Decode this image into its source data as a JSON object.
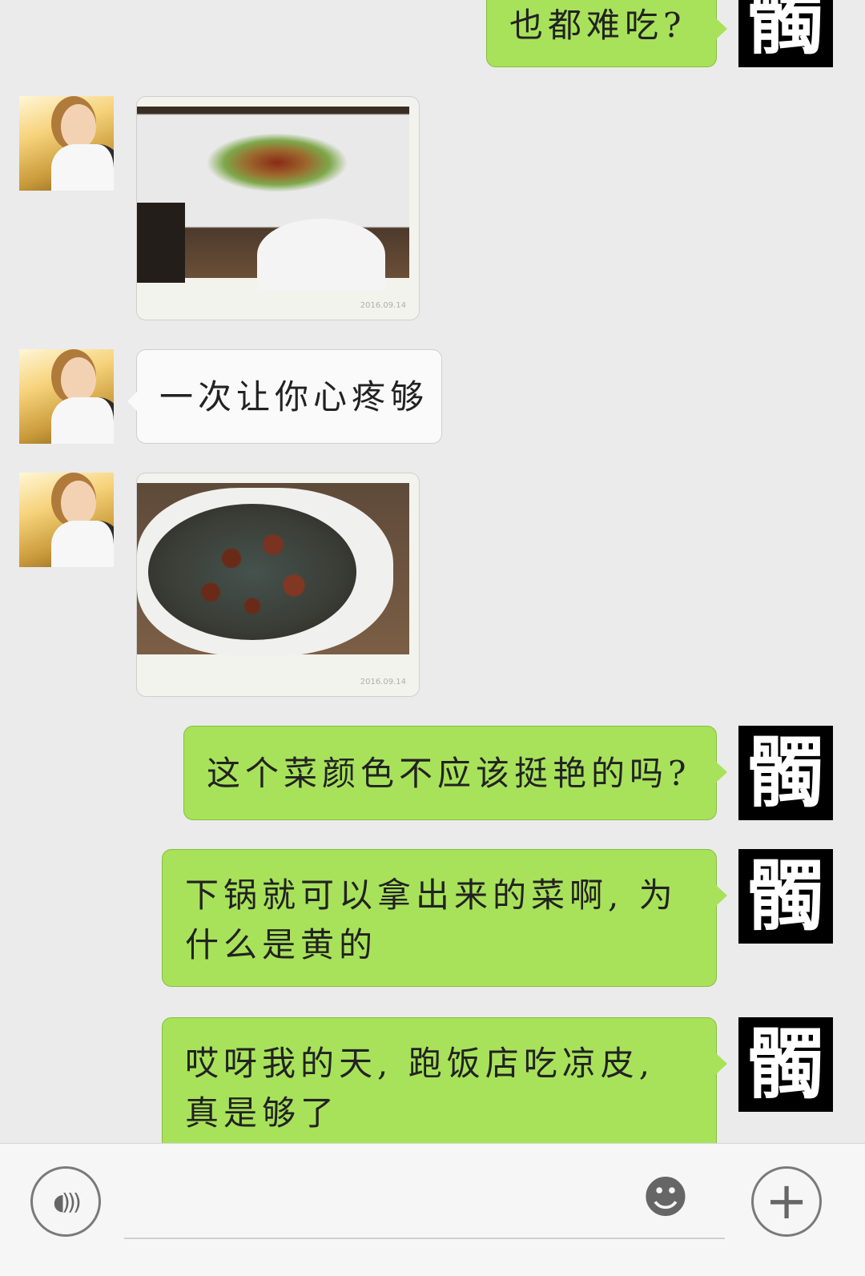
{
  "messages": [
    {
      "side": "right",
      "text": "也都难吃?"
    },
    {
      "side": "left",
      "type": "image",
      "image": "food photo - salad dish",
      "caption": "2016.09.14"
    },
    {
      "side": "left",
      "text": "一次让你心疼够"
    },
    {
      "side": "left",
      "type": "image",
      "image": "food photo - peanut dish",
      "caption": "2016.09.14"
    },
    {
      "side": "right",
      "text": "这个菜颜色不应该挺艳的吗?"
    },
    {
      "side": "right",
      "line1": "下锅就可以拿出来的菜啊, 为",
      "line2": "什么是黄的"
    },
    {
      "side": "right",
      "line1": "哎呀我的天, 跑饭店吃凉皮,",
      "line2": "真是够了"
    }
  ],
  "avatars": {
    "self_char": "髑",
    "self_icon": "black-calligraphy-avatar",
    "friend_icon": "girl-photo-avatar"
  },
  "input_bar": {
    "voice_icon": "voice-wave-icon",
    "emoji_icon": "smiley-icon",
    "plus_icon": "plus-icon",
    "voice_glyph": "◖)))",
    "emoji_glyph": "☻",
    "plus_glyph": "+"
  },
  "colors": {
    "background": "#ebebeb",
    "sent_bubble": "#a8e25a",
    "received_bubble": "#fafafa"
  }
}
